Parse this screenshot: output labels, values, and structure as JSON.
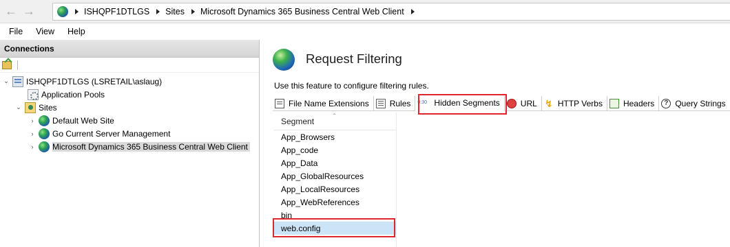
{
  "address_bar": {
    "breadcrumbs": [
      "ISHQPF1DTLGS",
      "Sites",
      "Microsoft Dynamics 365 Business Central Web Client"
    ]
  },
  "menu": [
    "File",
    "View",
    "Help"
  ],
  "connections": {
    "title": "Connections",
    "tree": [
      {
        "label": "ISHQPF1DTLGS (LSRETAIL\\aslaug)",
        "icon": "server-icon",
        "expanded": true
      },
      {
        "label": "Application Pools",
        "icon": "app-pools-icon"
      },
      {
        "label": "Sites",
        "icon": "sites-folder-icon",
        "expanded": true
      },
      {
        "label": "Default Web Site",
        "icon": "globe-icon"
      },
      {
        "label": "Go Current Server Management",
        "icon": "globe-icon"
      },
      {
        "label": "Microsoft Dynamics 365 Business Central Web Client",
        "icon": "globe-icon",
        "selected": true
      }
    ]
  },
  "feature": {
    "title": "Request Filtering",
    "description": "Use this feature to configure filtering rules."
  },
  "tabs": [
    {
      "label": "File Name Extensions",
      "icon": "file-extension-icon"
    },
    {
      "label": "Rules",
      "icon": "rules-icon"
    },
    {
      "label": "Hidden Segments",
      "icon": "hidden-segments-icon",
      "icon_text": "0101\n0110",
      "active": true
    },
    {
      "label": "URL",
      "icon": "url-block-icon"
    },
    {
      "label": "HTTP Verbs",
      "icon": "lightning-icon"
    },
    {
      "label": "Headers",
      "icon": "headers-icon"
    },
    {
      "label": "Query Strings",
      "icon": "question-icon",
      "icon_text": "?"
    }
  ],
  "segments": {
    "column_header": "Segment",
    "rows": [
      "App_Browsers",
      "App_code",
      "App_Data",
      "App_GlobalResources",
      "App_LocalResources",
      "App_WebReferences",
      "bin",
      "web.config"
    ],
    "selected": "web.config"
  },
  "colors": {
    "highlight_box": "#e0262a",
    "selection": "#cce4f7"
  }
}
